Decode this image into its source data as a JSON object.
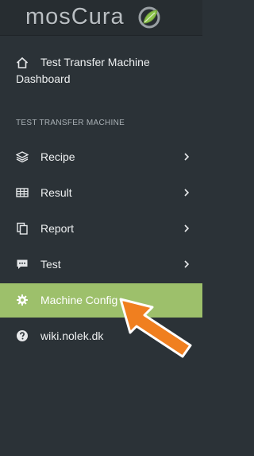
{
  "logo": {
    "text": "mosCura"
  },
  "dashboard": {
    "line1": "Test Transfer Machine",
    "line2": "Dashboard",
    "icon": "home-icon"
  },
  "section": {
    "header": "TEST TRANSFER MACHINE"
  },
  "nav": [
    {
      "label": "Recipe",
      "icon": "layers-icon",
      "has_submenu": true
    },
    {
      "label": "Result",
      "icon": "table-icon",
      "has_submenu": true
    },
    {
      "label": "Report",
      "icon": "copy-icon",
      "has_submenu": true
    },
    {
      "label": "Test",
      "icon": "comment-icon",
      "has_submenu": true
    },
    {
      "label": "Machine Config",
      "icon": "gear-icon",
      "active": true,
      "has_submenu": false
    },
    {
      "label": "wiki.nolek.dk",
      "icon": "question-circle-icon",
      "has_submenu": false
    }
  ],
  "colors": {
    "sidebar_bg": "#2b3237",
    "active_bg": "#9dc06b",
    "annotation_arrow": "#f07f1f",
    "logo_accent": "#8bc34a"
  }
}
